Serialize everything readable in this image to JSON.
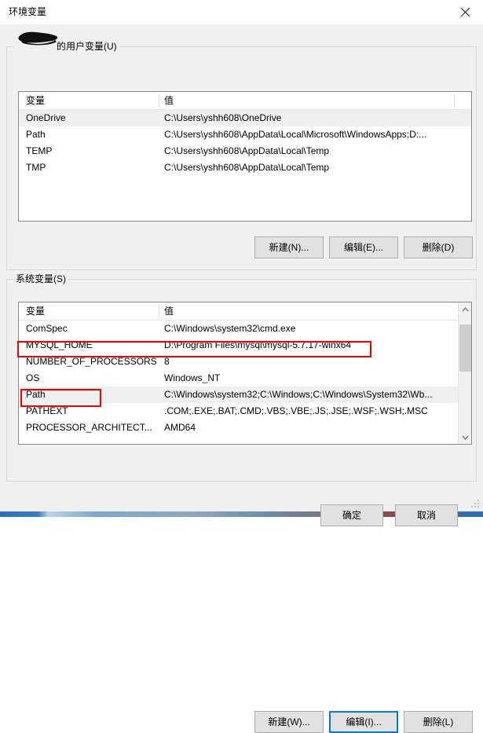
{
  "window": {
    "title": "环境变量",
    "close_icon": "close-icon"
  },
  "user_section": {
    "label_suffix": "的用户变量(U)",
    "username_redacted": true,
    "columns": {
      "variable": "变量",
      "value": "值"
    },
    "rows": [
      {
        "variable": "OneDrive",
        "value": "C:\\Users\\yshh608\\OneDrive",
        "selected": true
      },
      {
        "variable": "Path",
        "value": "C:\\Users\\yshh608\\AppData\\Local\\Microsoft\\WindowsApps;D:...",
        "selected": false
      },
      {
        "variable": "TEMP",
        "value": "C:\\Users\\yshh608\\AppData\\Local\\Temp",
        "selected": false
      },
      {
        "variable": "TMP",
        "value": "C:\\Users\\yshh608\\AppData\\Local\\Temp",
        "selected": false
      }
    ],
    "buttons": {
      "new": "新建(N)...",
      "edit": "编辑(E)...",
      "delete": "删除(D)"
    }
  },
  "system_section": {
    "label": "系统变量(S)",
    "columns": {
      "variable": "变量",
      "value": "值"
    },
    "rows": [
      {
        "variable": "ComSpec",
        "value": "C:\\Windows\\system32\\cmd.exe",
        "selected": false
      },
      {
        "variable": "MYSQL_HOME",
        "value": "D:\\Program Files\\mysql\\mysql-5.7.17-winx64",
        "selected": false
      },
      {
        "variable": "NUMBER_OF_PROCESSORS",
        "value": "8",
        "selected": false
      },
      {
        "variable": "OS",
        "value": "Windows_NT",
        "selected": false
      },
      {
        "variable": "Path",
        "value": "C:\\Windows\\system32;C:\\Windows;C:\\Windows\\System32\\Wb...",
        "selected": true
      },
      {
        "variable": "PATHEXT",
        "value": ".COM;.EXE;.BAT;.CMD;.VBS;.VBE;.JS;.JSE;.WSF;.WSH;.MSC",
        "selected": false
      },
      {
        "variable": "PROCESSOR_ARCHITECT...",
        "value": "AMD64",
        "selected": false
      }
    ],
    "buttons": {
      "new": "新建(W)...",
      "edit": "编辑(I)...",
      "delete": "删除(L)"
    },
    "scrollbar": {
      "up_icon": "chevron-up-icon",
      "down_icon": "chevron-down-icon"
    }
  },
  "dialog_buttons": {
    "ok": "确定",
    "cancel": "取消"
  },
  "annotations": {
    "accent_color": "#e60000",
    "boxes": [
      {
        "name": "mysql-home-row",
        "target": "MYSQL_HOME"
      },
      {
        "name": "system-path-variable",
        "target": "Path"
      }
    ]
  }
}
